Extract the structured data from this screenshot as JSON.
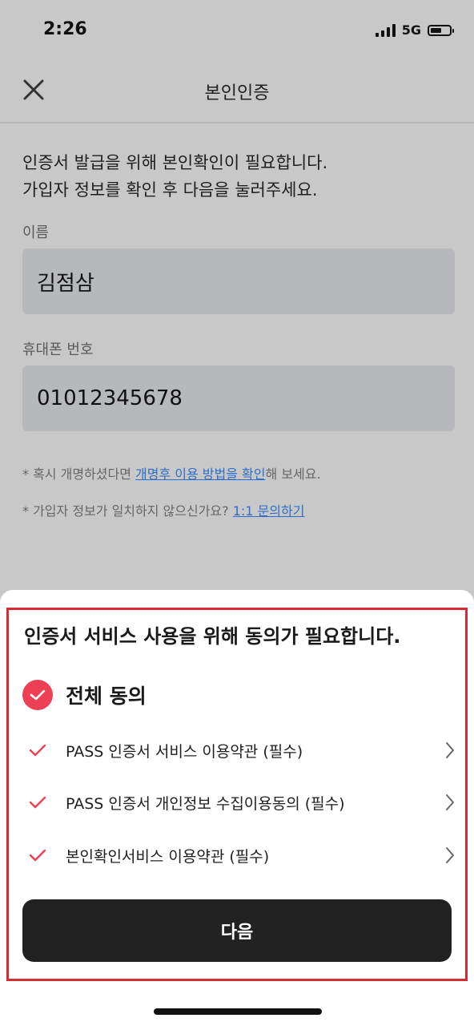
{
  "status_bar": {
    "time": "2:26",
    "network": "5G",
    "battery_level": 0.6
  },
  "nav": {
    "title": "본인인증",
    "close_icon": "close-icon"
  },
  "intro": {
    "line1": "인증서 발급을 위해 본인확인이 필요합니다.",
    "line2": "가입자 정보를 확인 후 다음을 눌러주세요."
  },
  "form": {
    "name_label": "이름",
    "name_value": "김점삼",
    "phone_label": "휴대폰 번호",
    "phone_value": "01012345678"
  },
  "notes": {
    "rename_prefix": "* 혹시 개명하셨다면 ",
    "rename_link": "개명후 이용 방법을 확인",
    "rename_suffix": "해 보세요.",
    "mismatch_prefix": "* 가입자 정보가 일치하지 않으신가요? ",
    "mismatch_link": "1:1 문의하기"
  },
  "sheet": {
    "title": "인증서 서비스 사용을 위해 동의가 필요합니다.",
    "agree_all": "전체 동의",
    "terms": [
      {
        "label": "PASS  인증서 서비스 이용약관 (필수)"
      },
      {
        "label": "PASS 인증서 개인정보 수집이용동의 (필수)"
      },
      {
        "label": "본인확인서비스 이용약관 (필수)"
      }
    ],
    "next_button": "다음"
  },
  "colors": {
    "accent": "#ee4054",
    "highlight_border": "#d42b35",
    "link": "#2c6ec9",
    "button_bg": "#222222"
  }
}
